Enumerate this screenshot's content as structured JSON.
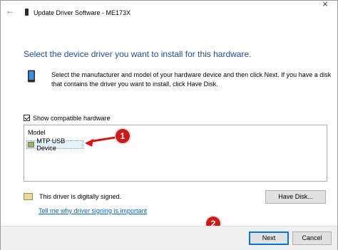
{
  "window": {
    "title": "Update Driver Software - ME173X",
    "back_glyph": "←",
    "close_glyph": "×"
  },
  "heading": "Select the device driver you want to install for this hardware.",
  "description": "Select the manufacturer and model of your hardware device and then click Next. If you have a disk that contains the driver you want to install, click Have Disk.",
  "compatible_checkbox": {
    "label": "Show compatible hardware",
    "checked": true
  },
  "model_list": {
    "column_header": "Model",
    "items": [
      "MTP USB Device"
    ]
  },
  "signature": {
    "status": "This driver is digitally signed.",
    "link": "Tell me why driver signing is important"
  },
  "buttons": {
    "have_disk": "Have Disk...",
    "next": "Next",
    "cancel": "Cancel"
  },
  "callouts": [
    "1",
    "2"
  ],
  "colors": {
    "heading": "#1f4e9d",
    "link": "#0066cc",
    "callout": "#cc1a1a",
    "default_button_border": "#0078d7"
  },
  "icons": {
    "back": "back-arrow-icon",
    "device": "device-icon",
    "list_item": "usb-device-icon",
    "certificate": "certificate-icon",
    "close": "close-icon"
  }
}
